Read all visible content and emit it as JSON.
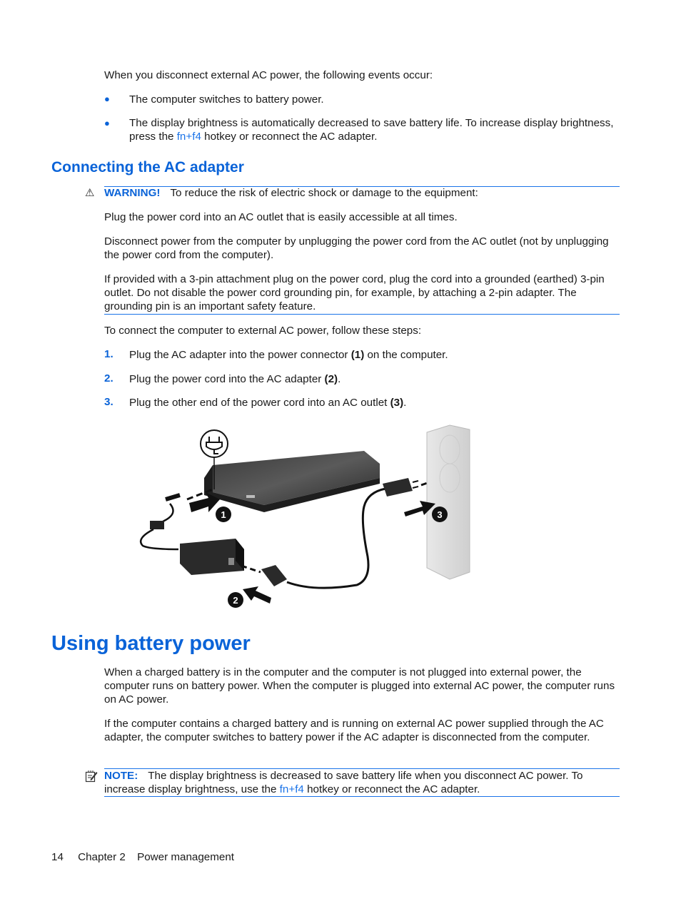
{
  "intro": {
    "text": "When you disconnect external AC power, the following events occur:",
    "bullets": [
      {
        "text": "The computer switches to battery power."
      },
      {
        "pre": "The display brightness is automatically decreased to save battery life. To increase display brightness, press the ",
        "link": "fn+f4",
        "post": " hotkey or reconnect the AC adapter."
      }
    ]
  },
  "section_ac": {
    "heading": "Connecting the AC adapter",
    "warning": {
      "icon": "warning-triangle-icon",
      "label": "WARNING!",
      "text": "To reduce the risk of electric shock or damage to the equipment:",
      "paragraphs": [
        "Plug the power cord into an AC outlet that is easily accessible at all times.",
        "Disconnect power from the computer by unplugging the power cord from the AC outlet (not by unplugging the power cord from the computer).",
        "If provided with a 3-pin attachment plug on the power cord, plug the cord into a grounded (earthed) 3-pin outlet. Do not disable the power cord grounding pin, for example, by attaching a 2-pin adapter. The grounding pin is an important safety feature."
      ]
    },
    "steps_intro": "To connect the computer to external AC power, follow these steps:",
    "steps": [
      {
        "num": "1.",
        "pre": "Plug the AC adapter into the power connector ",
        "bold": "(1)",
        "post": " on the computer."
      },
      {
        "num": "2.",
        "pre": "Plug the power cord into the AC adapter ",
        "bold": "(2)",
        "post": "."
      },
      {
        "num": "3.",
        "pre": "Plug the other end of the power cord into an AC outlet ",
        "bold": "(3)",
        "post": "."
      }
    ],
    "figure": {
      "callouts": [
        "1",
        "2",
        "3"
      ]
    }
  },
  "section_battery": {
    "heading": "Using battery power",
    "paragraphs": [
      "When a charged battery is in the computer and the computer is not plugged into external power, the computer runs on battery power. When the computer is plugged into external AC power, the computer runs on AC power.",
      "If the computer contains a charged battery and is running on external AC power supplied through the AC adapter, the computer switches to battery power if the AC adapter is disconnected from the computer."
    ],
    "note": {
      "icon": "note-pencil-icon",
      "label": "NOTE:",
      "pre": "The display brightness is decreased to save battery life when you disconnect AC power. To increase display brightness, use the ",
      "link": "fn+f4",
      "post": " hotkey or reconnect the AC adapter."
    }
  },
  "footer": {
    "page_number": "14",
    "chapter": "Chapter 2",
    "chapter_title": "Power management"
  }
}
